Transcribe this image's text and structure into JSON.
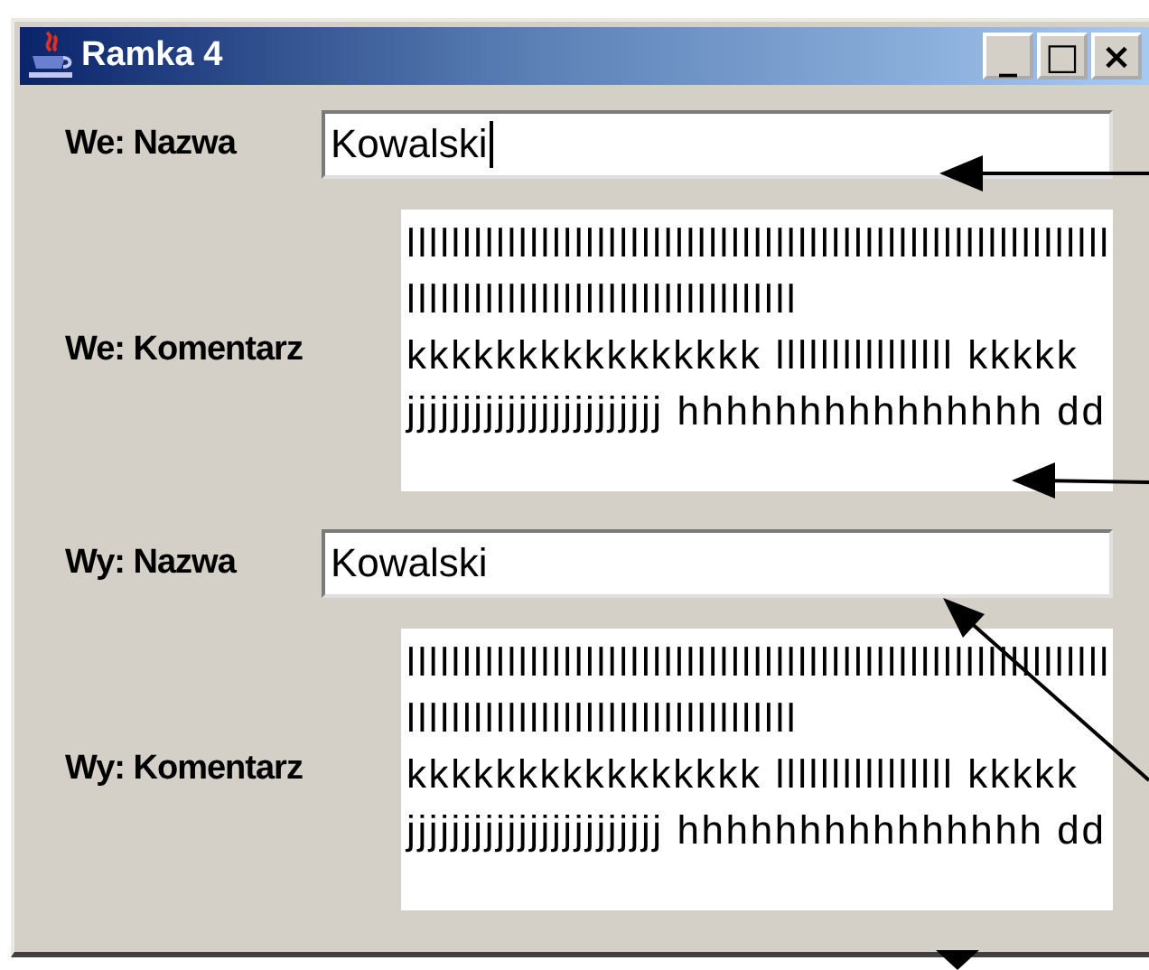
{
  "window": {
    "title": "Ramka 4",
    "buttons": [
      "_",
      "□",
      "×"
    ]
  },
  "rows": [
    {
      "kind": "field",
      "label": "We: Nazwa",
      "value": "Kowalski",
      "focused": true
    },
    {
      "kind": "area",
      "label": "We: Komentarz",
      "lines": [
        "lllllllllllllllllllllllllllllllllllllllllllllllllllllllllllllll",
        "lllllllllllllllllllllllllllllllllll",
        "kkkkkkkkkkkkkkkk llllllllllllllll kkkkk",
        "jjjjjjjjjjjjjjjjjjjjjjj hhhhhhhhhhhhhhh dd"
      ]
    },
    {
      "kind": "field",
      "label": "Wy: Nazwa",
      "value": "Kowalski",
      "focused": false
    },
    {
      "kind": "area",
      "label": "Wy: Komentarz",
      "lines": [
        "lllllllllllllllllllllllllllllllllllllllllllllllllllllllllllllll",
        "lllllllllllllllllllllllllllllllllll",
        "kkkkkkkkkkkkkkkk llllllllllllllll kkkkk",
        "jjjjjjjjjjjjjjjjjjjjjjj hhhhhhhhhhhhhhh dd"
      ]
    }
  ]
}
